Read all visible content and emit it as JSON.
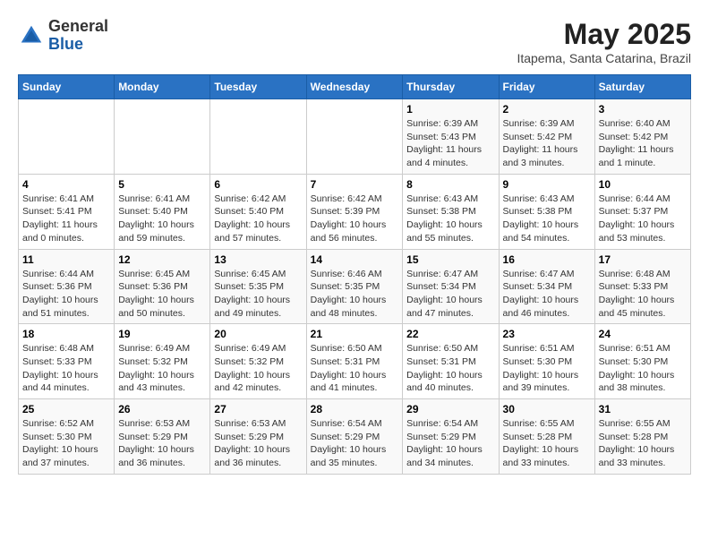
{
  "header": {
    "logo_general": "General",
    "logo_blue": "Blue",
    "title": "May 2025",
    "subtitle": "Itapema, Santa Catarina, Brazil"
  },
  "weekdays": [
    "Sunday",
    "Monday",
    "Tuesday",
    "Wednesday",
    "Thursday",
    "Friday",
    "Saturday"
  ],
  "weeks": [
    [
      {
        "day": "",
        "info": ""
      },
      {
        "day": "",
        "info": ""
      },
      {
        "day": "",
        "info": ""
      },
      {
        "day": "",
        "info": ""
      },
      {
        "day": "1",
        "info": "Sunrise: 6:39 AM\nSunset: 5:43 PM\nDaylight: 11 hours and 4 minutes."
      },
      {
        "day": "2",
        "info": "Sunrise: 6:39 AM\nSunset: 5:42 PM\nDaylight: 11 hours and 3 minutes."
      },
      {
        "day": "3",
        "info": "Sunrise: 6:40 AM\nSunset: 5:42 PM\nDaylight: 11 hours and 1 minute."
      }
    ],
    [
      {
        "day": "4",
        "info": "Sunrise: 6:41 AM\nSunset: 5:41 PM\nDaylight: 11 hours and 0 minutes."
      },
      {
        "day": "5",
        "info": "Sunrise: 6:41 AM\nSunset: 5:40 PM\nDaylight: 10 hours and 59 minutes."
      },
      {
        "day": "6",
        "info": "Sunrise: 6:42 AM\nSunset: 5:40 PM\nDaylight: 10 hours and 57 minutes."
      },
      {
        "day": "7",
        "info": "Sunrise: 6:42 AM\nSunset: 5:39 PM\nDaylight: 10 hours and 56 minutes."
      },
      {
        "day": "8",
        "info": "Sunrise: 6:43 AM\nSunset: 5:38 PM\nDaylight: 10 hours and 55 minutes."
      },
      {
        "day": "9",
        "info": "Sunrise: 6:43 AM\nSunset: 5:38 PM\nDaylight: 10 hours and 54 minutes."
      },
      {
        "day": "10",
        "info": "Sunrise: 6:44 AM\nSunset: 5:37 PM\nDaylight: 10 hours and 53 minutes."
      }
    ],
    [
      {
        "day": "11",
        "info": "Sunrise: 6:44 AM\nSunset: 5:36 PM\nDaylight: 10 hours and 51 minutes."
      },
      {
        "day": "12",
        "info": "Sunrise: 6:45 AM\nSunset: 5:36 PM\nDaylight: 10 hours and 50 minutes."
      },
      {
        "day": "13",
        "info": "Sunrise: 6:45 AM\nSunset: 5:35 PM\nDaylight: 10 hours and 49 minutes."
      },
      {
        "day": "14",
        "info": "Sunrise: 6:46 AM\nSunset: 5:35 PM\nDaylight: 10 hours and 48 minutes."
      },
      {
        "day": "15",
        "info": "Sunrise: 6:47 AM\nSunset: 5:34 PM\nDaylight: 10 hours and 47 minutes."
      },
      {
        "day": "16",
        "info": "Sunrise: 6:47 AM\nSunset: 5:34 PM\nDaylight: 10 hours and 46 minutes."
      },
      {
        "day": "17",
        "info": "Sunrise: 6:48 AM\nSunset: 5:33 PM\nDaylight: 10 hours and 45 minutes."
      }
    ],
    [
      {
        "day": "18",
        "info": "Sunrise: 6:48 AM\nSunset: 5:33 PM\nDaylight: 10 hours and 44 minutes."
      },
      {
        "day": "19",
        "info": "Sunrise: 6:49 AM\nSunset: 5:32 PM\nDaylight: 10 hours and 43 minutes."
      },
      {
        "day": "20",
        "info": "Sunrise: 6:49 AM\nSunset: 5:32 PM\nDaylight: 10 hours and 42 minutes."
      },
      {
        "day": "21",
        "info": "Sunrise: 6:50 AM\nSunset: 5:31 PM\nDaylight: 10 hours and 41 minutes."
      },
      {
        "day": "22",
        "info": "Sunrise: 6:50 AM\nSunset: 5:31 PM\nDaylight: 10 hours and 40 minutes."
      },
      {
        "day": "23",
        "info": "Sunrise: 6:51 AM\nSunset: 5:30 PM\nDaylight: 10 hours and 39 minutes."
      },
      {
        "day": "24",
        "info": "Sunrise: 6:51 AM\nSunset: 5:30 PM\nDaylight: 10 hours and 38 minutes."
      }
    ],
    [
      {
        "day": "25",
        "info": "Sunrise: 6:52 AM\nSunset: 5:30 PM\nDaylight: 10 hours and 37 minutes."
      },
      {
        "day": "26",
        "info": "Sunrise: 6:53 AM\nSunset: 5:29 PM\nDaylight: 10 hours and 36 minutes."
      },
      {
        "day": "27",
        "info": "Sunrise: 6:53 AM\nSunset: 5:29 PM\nDaylight: 10 hours and 36 minutes."
      },
      {
        "day": "28",
        "info": "Sunrise: 6:54 AM\nSunset: 5:29 PM\nDaylight: 10 hours and 35 minutes."
      },
      {
        "day": "29",
        "info": "Sunrise: 6:54 AM\nSunset: 5:29 PM\nDaylight: 10 hours and 34 minutes."
      },
      {
        "day": "30",
        "info": "Sunrise: 6:55 AM\nSunset: 5:28 PM\nDaylight: 10 hours and 33 minutes."
      },
      {
        "day": "31",
        "info": "Sunrise: 6:55 AM\nSunset: 5:28 PM\nDaylight: 10 hours and 33 minutes."
      }
    ]
  ]
}
